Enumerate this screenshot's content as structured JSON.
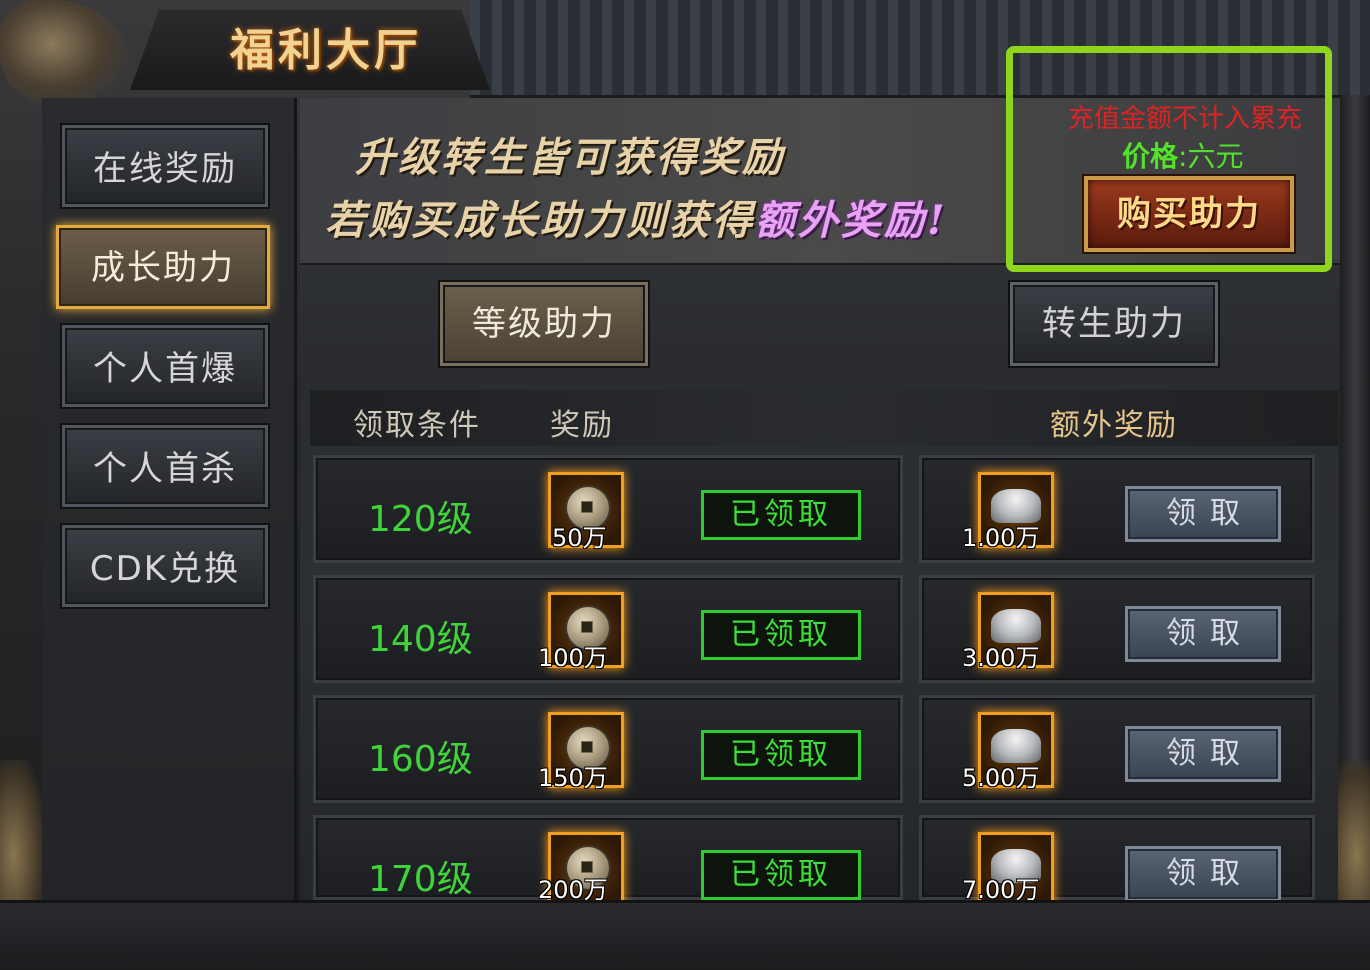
{
  "window": {
    "title": "福利大厅"
  },
  "sidebar": {
    "items": [
      {
        "label": "在线奖励",
        "active": false
      },
      {
        "label": "成长助力",
        "active": true
      },
      {
        "label": "个人首爆",
        "active": false
      },
      {
        "label": "个人首杀",
        "active": false
      },
      {
        "label": "CDK兑换",
        "active": false
      }
    ]
  },
  "banner": {
    "line1": "升级转生皆可获得奖励",
    "line2_prefix": "若购买成长助力则获得",
    "line2_emphasis": "额外奖励!"
  },
  "purchase": {
    "note": "充值金额不计入累充",
    "price_label": "价格",
    "price_separator": ":",
    "price_value": "六元",
    "buy_label": "购买助力"
  },
  "tabs": [
    {
      "label": "等级助力",
      "active": true
    },
    {
      "label": "转生助力",
      "active": false
    }
  ],
  "table": {
    "headers": {
      "condition": "领取条件",
      "reward": "奖励",
      "extra": "额外奖励"
    },
    "rows": [
      {
        "level": "120级",
        "reward_icon": "copper-coin-icon",
        "reward_qty": "50万",
        "status": "已领取",
        "extra_icon": "silver-ingot-icon",
        "extra_qty": "1.00万",
        "claim_label": "领取"
      },
      {
        "level": "140级",
        "reward_icon": "copper-coin-icon",
        "reward_qty": "100万",
        "status": "已领取",
        "extra_icon": "silver-ingot-icon",
        "extra_qty": "3.00万",
        "claim_label": "领取"
      },
      {
        "level": "160级",
        "reward_icon": "copper-coin-icon",
        "reward_qty": "150万",
        "status": "已领取",
        "extra_icon": "silver-ingot-icon",
        "extra_qty": "5.00万",
        "claim_label": "领取"
      },
      {
        "level": "170级",
        "reward_icon": "copper-coin-icon",
        "reward_qty": "200万",
        "status": "已领取",
        "extra_icon": "silver-ingot-icon",
        "extra_qty": "7.00万",
        "claim_label": "领取"
      }
    ]
  },
  "colors": {
    "level_green": "#3ed43a",
    "highlight_box": "#8ed61c",
    "note_red": "#e12222",
    "price_green": "#52e22a",
    "emphasis_purple": "#e9a2f5",
    "slot_orange": "#f0a020"
  }
}
